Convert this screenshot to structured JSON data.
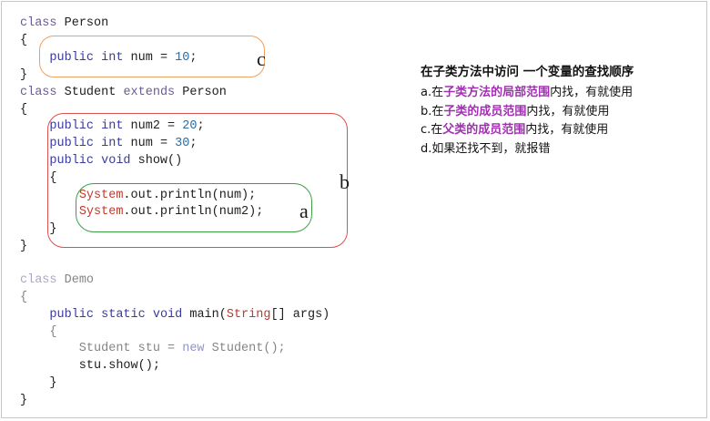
{
  "code_lines": [
    "class Person",
    "{",
    "    public int num = 10;",
    "}",
    "class Student extends Person",
    "{",
    "    public int num2 = 20;",
    "    public int num = 30;",
    "    public void show()",
    "    {",
    "        System.out.println(num);",
    "        System.out.println(num2);",
    "    }",
    "}",
    "",
    "class Demo",
    "{",
    "    public static void main(String[] args)",
    "    {",
    "        Student stu = new Student();",
    "        stu.show();",
    "    }",
    "}"
  ],
  "markers": {
    "a": "a",
    "b": "b",
    "c": "c"
  },
  "panel": {
    "title": "在子类方法中访问 一个变量的查找顺序",
    "steps": [
      {
        "prefix": "a.在",
        "highlight": "子类方法的局部范围",
        "suffix": "内找，有就使用"
      },
      {
        "prefix": "b.在",
        "highlight": "子类的成员范围",
        "suffix": "内找，有就使用"
      },
      {
        "prefix": "c.在",
        "highlight": "父类的成员范围",
        "suffix": "内找，有就使用"
      },
      {
        "prefix": "d.如果还找不到，就报错",
        "highlight": "",
        "suffix": ""
      }
    ]
  },
  "colors": {
    "orange_box": "#f0a060",
    "red_box": "#e05050",
    "green_box": "#3aa043",
    "highlight": "#a030b0"
  }
}
